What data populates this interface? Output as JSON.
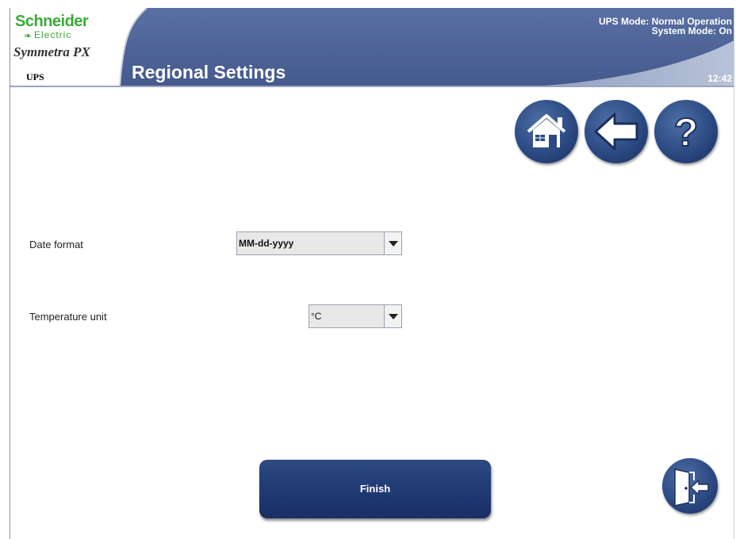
{
  "header": {
    "brand": "Schneider",
    "brand_sub": "Electric",
    "product": "Symmetra PX",
    "device": "UPS",
    "title": "Regional Settings",
    "status_line1": "UPS Mode: Normal Operation",
    "status_line2": "System Mode: On",
    "clock": "12:42"
  },
  "nav": {
    "icons": [
      "home-icon",
      "back-arrow-icon",
      "help-icon",
      "logout-door-icon"
    ]
  },
  "form": {
    "date_format": {
      "label": "Date format",
      "value": "MM-dd-yyyy"
    },
    "temperature_unit": {
      "label": "Temperature unit",
      "value": "°C"
    }
  },
  "actions": {
    "finish_label": "Finish"
  },
  "colors": {
    "header_blue": "#4a5f92",
    "button_blue": "#1f3872",
    "brand_green": "#3aaa35"
  }
}
